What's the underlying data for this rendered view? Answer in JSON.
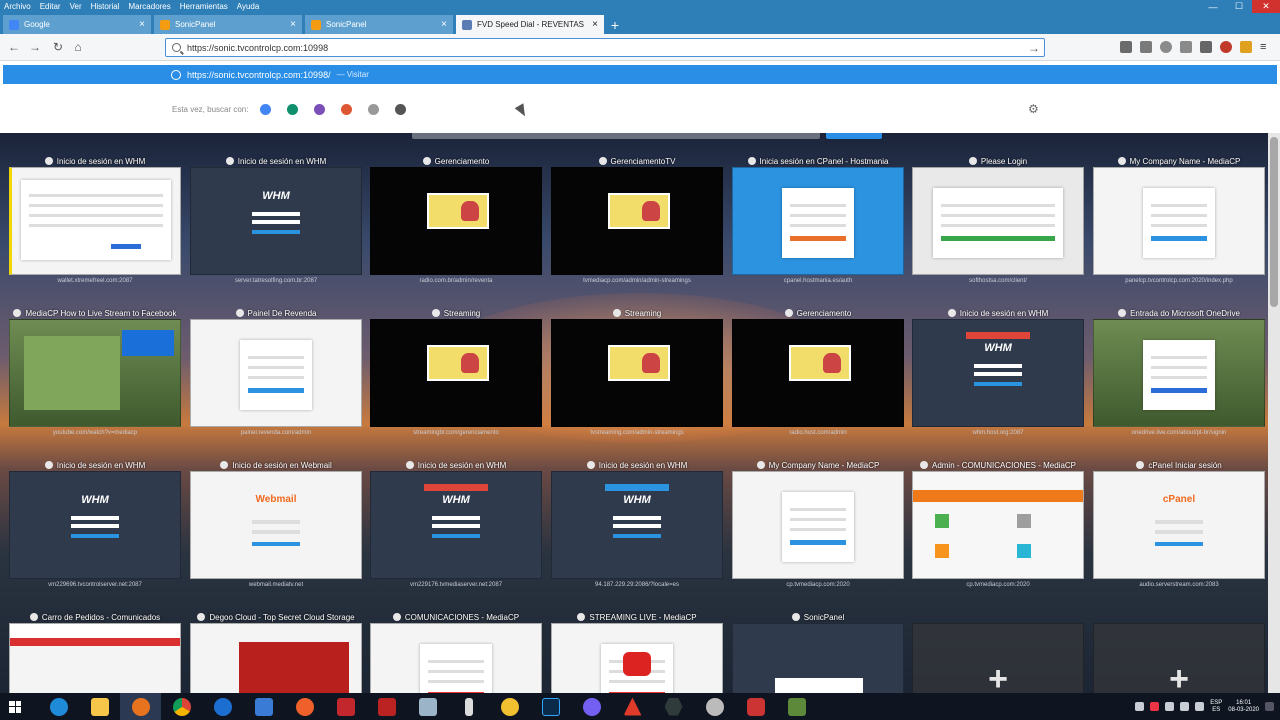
{
  "menu": [
    "Archivo",
    "Editar",
    "Ver",
    "Historial",
    "Marcadores",
    "Herramientas",
    "Ayuda"
  ],
  "tabs": [
    {
      "title": "Google",
      "color": "#4285f4",
      "active": false
    },
    {
      "title": "SonicPanel",
      "color": "#f39c12",
      "active": false
    },
    {
      "title": "SonicPanel",
      "color": "#f39c12",
      "active": false
    },
    {
      "title": "FVD Speed Dial - REVENTAS",
      "color": "#5b7bb5",
      "active": true
    }
  ],
  "nav": {
    "url": "https://sonic.tvcontrolcp.com:10998",
    "dropdown_url": "https://sonic.tvcontrolcp.com:10998/",
    "dropdown_action": "— Visitar",
    "search_label": "Esta vez, buscar con:",
    "search_engines": [
      {
        "name": "google",
        "color": "#4285f4"
      },
      {
        "name": "bing",
        "color": "#0f8f6b"
      },
      {
        "name": "yahoo",
        "color": "#7b4fb8"
      },
      {
        "name": "duckduckgo",
        "color": "#de5833"
      },
      {
        "name": "ebay",
        "color": "#999999"
      },
      {
        "name": "wikipedia",
        "color": "#555555"
      }
    ]
  },
  "dials": [
    {
      "title": "Inicio de sesión en WHM",
      "sub": "wallet.xtremefreel.com:2087",
      "type": "t-white",
      "kind": "warn"
    },
    {
      "title": "Inicio de sesión en WHM",
      "sub": "server.tatresolfing.com.br:2087",
      "type": "t-dark",
      "kind": "whm"
    },
    {
      "title": "Gerenciamento",
      "sub": "radio.com.br/admin/reventa",
      "type": "t-black",
      "kind": "cp"
    },
    {
      "title": "GerenciamentoTV",
      "sub": "tvmediacp.com/admin/admin-streamings",
      "type": "t-black",
      "kind": "cp"
    },
    {
      "title": "Inicia sesión en CPanel - Hostmania",
      "sub": "cpanel.hostmania.es/auth",
      "type": "t-blue",
      "kind": "card-orange"
    },
    {
      "title": "Please Login",
      "sub": "softhostsa.com/client/",
      "type": "t-gray",
      "kind": "login-green"
    },
    {
      "title": "My Company Name - MediaCP",
      "sub": "panelcp.tvcontrolcp.com:2020/index.php",
      "type": "t-white",
      "kind": "mediacp"
    },
    {
      "title": "MediaCP How to Live Stream to Facebook",
      "sub": "youtube.com/watch?v=mediacp",
      "type": "t-photo",
      "kind": "video"
    },
    {
      "title": "Painel De Revenda",
      "sub": "painel.revenda.com/admin",
      "type": "t-white",
      "kind": "login-plain"
    },
    {
      "title": "Streaming",
      "sub": "streamingbr.com/gerenciamento",
      "type": "t-black",
      "kind": "cp"
    },
    {
      "title": "Streaming",
      "sub": "tvstreaming.com/admin-streamings",
      "type": "t-black",
      "kind": "cp"
    },
    {
      "title": "Gerenciamento",
      "sub": "radio.host.com/admin",
      "type": "t-black",
      "kind": "cp"
    },
    {
      "title": "Inicio de sesión en WHM",
      "sub": "whm.host.org:2087",
      "type": "t-dark",
      "kind": "whm-red"
    },
    {
      "title": "Entrada do Microsoft OneDrive",
      "sub": "onedrive.live.com/about/pt-br/signin",
      "type": "t-photo",
      "kind": "onedrive"
    },
    {
      "title": "Inicio de sesión en WHM",
      "sub": "vm229696.tvcontrolserver.net:2087",
      "type": "t-dark",
      "kind": "whm"
    },
    {
      "title": "Inicio de sesión en Webmail",
      "sub": "webmail.mediatv.net",
      "type": "t-white",
      "kind": "webmail"
    },
    {
      "title": "Inicio de sesión en WHM",
      "sub": "vm229176.tvmediaserver.net:2087",
      "type": "t-dark",
      "kind": "whm-red"
    },
    {
      "title": "Inicio de sesión en WHM",
      "sub": "94.187.229.29:2086/?locale=es",
      "type": "t-dark",
      "kind": "whm-blue"
    },
    {
      "title": "My Company Name - MediaCP",
      "sub": "cp.tvmediacp.com:2020",
      "type": "t-white",
      "kind": "mediacp"
    },
    {
      "title": "Admin - COMUNICACIONES - MediaCP",
      "sub": "cp.tvmediacp.com:2020",
      "type": "t-orange",
      "kind": "admin"
    },
    {
      "title": "cPanel Iniciar sesión",
      "sub": "audio.serverstream.com:2083",
      "type": "t-white",
      "kind": "cpanel"
    },
    {
      "title": "Carro de Pedidos - Comunicados",
      "sub": "",
      "type": "t-white",
      "kind": "shop"
    },
    {
      "title": "Degoo Cloud - Top Secret Cloud Storage",
      "sub": "",
      "type": "t-white",
      "kind": "degoo"
    },
    {
      "title": "COMUNICACIONES - MediaCP",
      "sub": "",
      "type": "t-white",
      "kind": "tvlogo"
    },
    {
      "title": "STREAMING LIVE - MediaCP",
      "sub": "",
      "type": "t-white",
      "kind": "tvlogo2"
    },
    {
      "title": "SonicPanel",
      "sub": "",
      "type": "t-dark",
      "kind": "sonic"
    },
    {
      "title": "",
      "sub": "",
      "type": "t-empty",
      "kind": "add"
    },
    {
      "title": "",
      "sub": "",
      "type": "t-empty",
      "kind": "add"
    }
  ],
  "tray": {
    "lang": "ESP\nES",
    "time": "16:01",
    "date": "08-03-2020"
  }
}
